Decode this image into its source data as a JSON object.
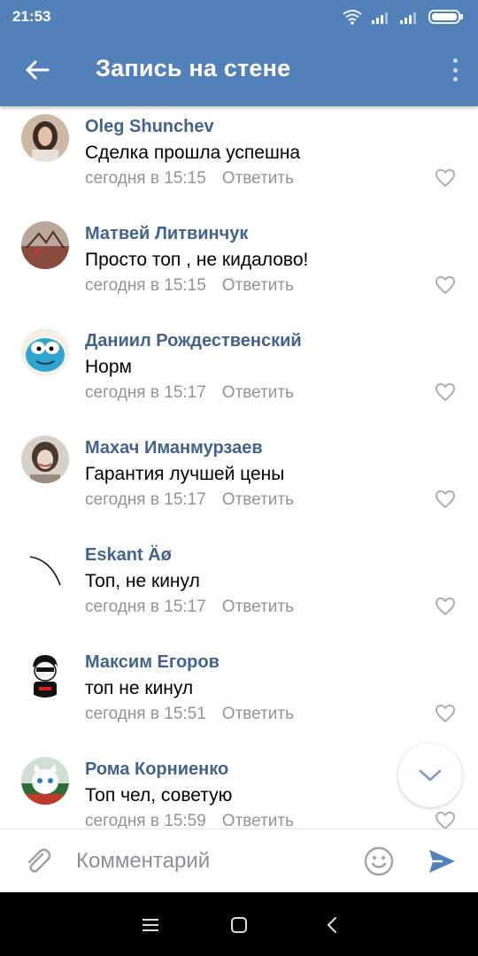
{
  "status_bar": {
    "time": "21:53"
  },
  "header": {
    "title": "Запись на стене"
  },
  "comments": [
    {
      "name": "Oleg Shunchev",
      "text": "Сделка прошла успешна",
      "time": "сегодня в 15:15",
      "reply_label": "Ответить"
    },
    {
      "name": "Матвей Литвинчук",
      "text": "Просто топ , не кидалово!",
      "time": "сегодня в 15:15",
      "reply_label": "Ответить"
    },
    {
      "name": "Даниил Рождественский",
      "text": "Норм",
      "time": "сегодня в 15:17",
      "reply_label": "Ответить"
    },
    {
      "name": "Махач Иманмурзаев",
      "text": "Гарантия лучшей цены",
      "time": "сегодня в 15:17",
      "reply_label": "Ответить"
    },
    {
      "name": "Eskant Äø",
      "text": "Топ, не кинул",
      "time": "сегодня в 15:17",
      "reply_label": "Ответить"
    },
    {
      "name": "Максим Егоров",
      "text": "топ не кинул",
      "time": "сегодня в 15:51",
      "reply_label": "Ответить"
    },
    {
      "name": "Рома Корниенко",
      "text": "Топ чел, советую",
      "time": "сегодня в 15:59",
      "reply_label": "Ответить"
    }
  ],
  "composer": {
    "placeholder": "Комментарий"
  },
  "colors": {
    "header": "#5181b8",
    "name": "#42648b",
    "meta": "#939393",
    "send": "#5181b8"
  },
  "icons": [
    "wifi-icon",
    "signal-icon",
    "battery-icon",
    "back-arrow-icon",
    "more-vert-icon",
    "heart-icon",
    "chevron-down-icon",
    "paperclip-icon",
    "emoji-icon",
    "send-icon",
    "menu-icon",
    "home-square-icon",
    "back-chevron-icon"
  ]
}
